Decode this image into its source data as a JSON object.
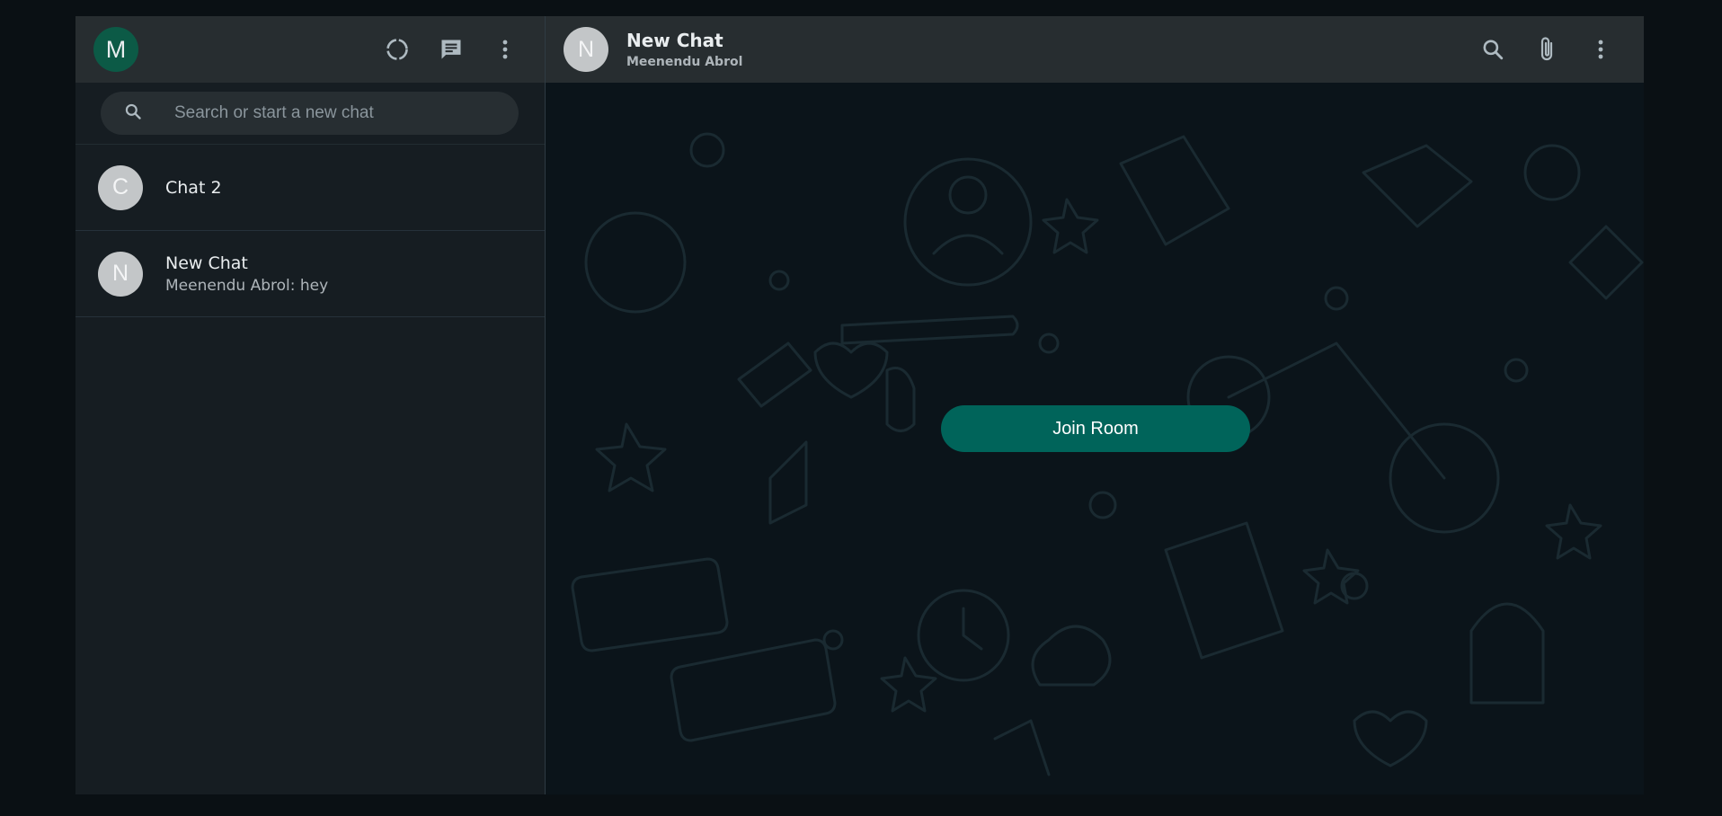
{
  "user": {
    "avatar_initial": "M"
  },
  "sidebar": {
    "icons": [
      "status-icon",
      "new-chat-icon",
      "menu-icon"
    ],
    "search": {
      "placeholder": "Search or start a new chat",
      "value": ""
    },
    "chats": [
      {
        "initial": "C",
        "name": "Chat 2",
        "preview": ""
      },
      {
        "initial": "N",
        "name": "New Chat",
        "preview": "Meenendu Abrol: hey"
      }
    ]
  },
  "conversation": {
    "initial": "N",
    "title": "New Chat",
    "subtitle": "Meenendu Abrol",
    "icons": [
      "search-icon",
      "attach-icon",
      "menu-icon"
    ],
    "join_label": "Join Room"
  },
  "colors": {
    "accent": "#00645a",
    "header_bg": "#272d30",
    "sidebar_bg": "#161d22",
    "chat_bg": "#0b141a",
    "my_avatar": "#0c5a46"
  }
}
